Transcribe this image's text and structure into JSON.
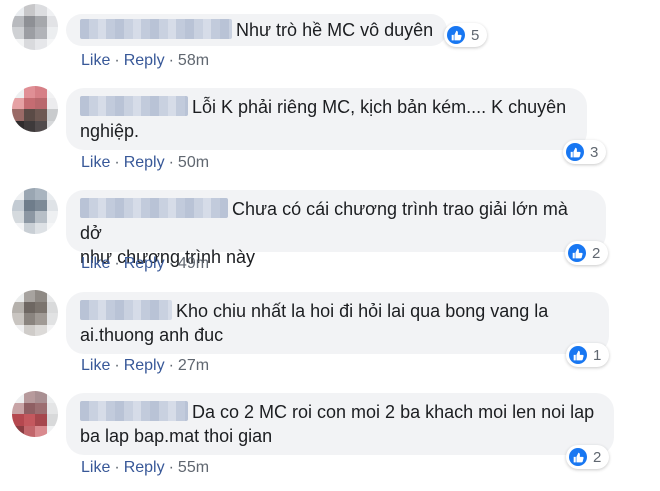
{
  "colors": {
    "link": "#385898",
    "bubble": "#f2f3f5",
    "like_badge": "#1877f2",
    "meta_text": "#606770"
  },
  "actions": {
    "like_label": "Like",
    "reply_label": "Reply",
    "separator": "·"
  },
  "comments": [
    {
      "text": "Như trò hề MC vô duyên",
      "time": "58m",
      "likes": "5",
      "icon": "like-icon"
    },
    {
      "text": "Lỗi K phải riêng MC, kịch bản kém.... K chuyên\nnghiệp.",
      "time": "50m",
      "likes": "3",
      "icon": "like-icon"
    },
    {
      "text": "Chưa có cái chương trình trao giải lớn mà dở\nnhư chương trình này",
      "time": "49m",
      "likes": "2",
      "icon": "like-icon"
    },
    {
      "text": "Kho chiu nhất la hoi đi hỏi lai qua bong vang la\nai.thuong anh đuc",
      "time": "27m",
      "likes": "1",
      "icon": "like-icon"
    },
    {
      "text": "Da co 2 MC roi con moi 2 ba khach moi len noi lap\nba lap bap.mat thoi gian",
      "time": "55m",
      "likes": "2",
      "icon": "like-icon"
    }
  ]
}
